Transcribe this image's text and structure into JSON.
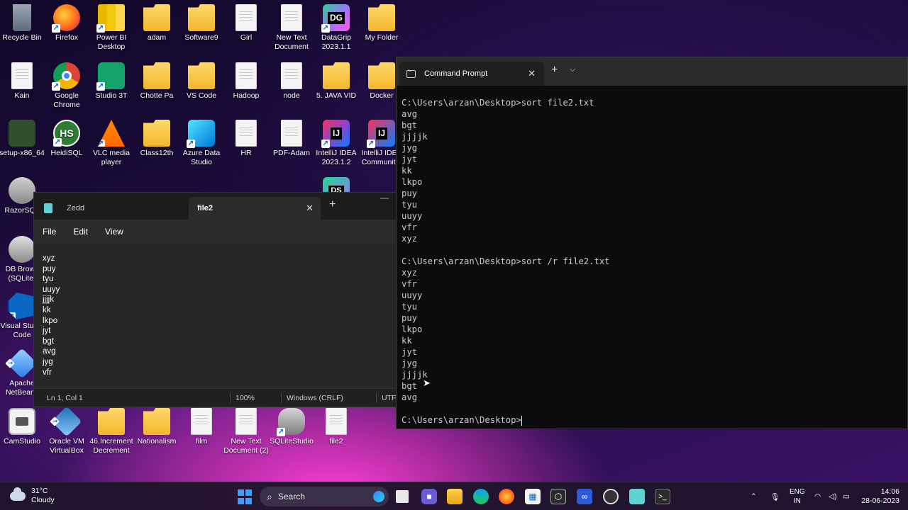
{
  "desktop": {
    "icons": [
      {
        "label": "Recycle Bin"
      },
      {
        "label": "Firefox"
      },
      {
        "label": "Power BI Desktop"
      },
      {
        "label": "adam"
      },
      {
        "label": "Software9"
      },
      {
        "label": "Girl"
      },
      {
        "label": "New Text Document"
      },
      {
        "label": "DataGrip 2023.1.1"
      },
      {
        "label": "My Folder"
      },
      {
        "label": "Kain"
      },
      {
        "label": "Google Chrome"
      },
      {
        "label": "Studio 3T"
      },
      {
        "label": "Chotte Pa"
      },
      {
        "label": "VS Code"
      },
      {
        "label": "Hadoop"
      },
      {
        "label": "node"
      },
      {
        "label": "5. JAVA VID"
      },
      {
        "label": "Docker"
      },
      {
        "label": "setup-x86_64"
      },
      {
        "label": "HeidiSQL"
      },
      {
        "label": "VLC media player"
      },
      {
        "label": "Class12th"
      },
      {
        "label": "Azure Data Studio"
      },
      {
        "label": "HR"
      },
      {
        "label": "PDF-Adam"
      },
      {
        "label": "IntelliJ IDEA 2023.1.2"
      },
      {
        "label": "IntelliJ IDEA Communit..."
      },
      {
        "label": "RazorSQL"
      },
      {
        "label": "DB Brows (SQLite)"
      },
      {
        "label": "Visual Studio Code"
      },
      {
        "label": "Apache NetBeans"
      },
      {
        "label": "CamStudio"
      },
      {
        "label": "Oracle VM VirtualBox"
      },
      {
        "label": "46.Increment Decrement"
      },
      {
        "label": "Nationalism"
      },
      {
        "label": "film"
      },
      {
        "label": "New Text Document (2)"
      },
      {
        "label": "SQLiteStudio"
      },
      {
        "label": "file2"
      }
    ],
    "icon_glyphs": {
      "datagrip": "DG",
      "heidisql": "HS",
      "intellij": "IJ",
      "datagrip2": "DS"
    }
  },
  "notepad": {
    "tabs": [
      {
        "label": "Zedd"
      },
      {
        "label": "file2"
      }
    ],
    "close_glyph": "✕",
    "new_tab_glyph": "+",
    "menu": {
      "file": "File",
      "edit": "Edit",
      "view": "View"
    },
    "lines": [
      "xyz",
      "puy",
      "tyu",
      "uuyy",
      "jjjjk",
      "kk",
      "lkpo",
      "jyt",
      "bgt",
      "avg",
      "jyg",
      "vfr"
    ],
    "status": {
      "position": "Ln 1, Col 1",
      "zoom": "100%",
      "line_endings": "Windows (CRLF)",
      "encoding": "UTF-"
    }
  },
  "terminal": {
    "tab_title": "Command Prompt",
    "close_glyph": "✕",
    "new_tab_glyph": "+",
    "dropdown_glyph": "⌵",
    "blocks": [
      {
        "command": "C:\\Users\\arzan\\Desktop>sort file2.txt",
        "output": [
          "avg",
          "bgt",
          "jjjjk",
          "jyg",
          "jyt",
          "kk",
          "lkpo",
          "puy",
          "tyu",
          "uuyy",
          "vfr",
          "xyz"
        ]
      },
      {
        "command": "C:\\Users\\arzan\\Desktop>sort /r file2.txt",
        "output": [
          "xyz",
          "vfr",
          "uuyy",
          "tyu",
          "puy",
          "lkpo",
          "kk",
          "jyt",
          "jyg",
          "jjjjk",
          "bgt",
          "avg"
        ]
      }
    ],
    "prompt": "C:\\Users\\arzan\\Desktop>"
  },
  "taskbar": {
    "weather_temp": "31°C",
    "weather_desc": "Cloudy",
    "search_placeholder": "Search",
    "lang_top": "ENG",
    "lang_bottom": "IN",
    "time": "14:06",
    "date": "28-06-2023",
    "icons": [
      "windows-start-icon",
      "search-icon",
      "copilot-icon",
      "task-view-icon",
      "teams-chat-icon",
      "file-explorer-icon",
      "edge-icon",
      "firefox-icon",
      "store-icon",
      "unity-icon",
      "vs-icon",
      "obs-icon",
      "notepad-icon",
      "terminal-icon"
    ],
    "accent": "#3aa0ff"
  }
}
